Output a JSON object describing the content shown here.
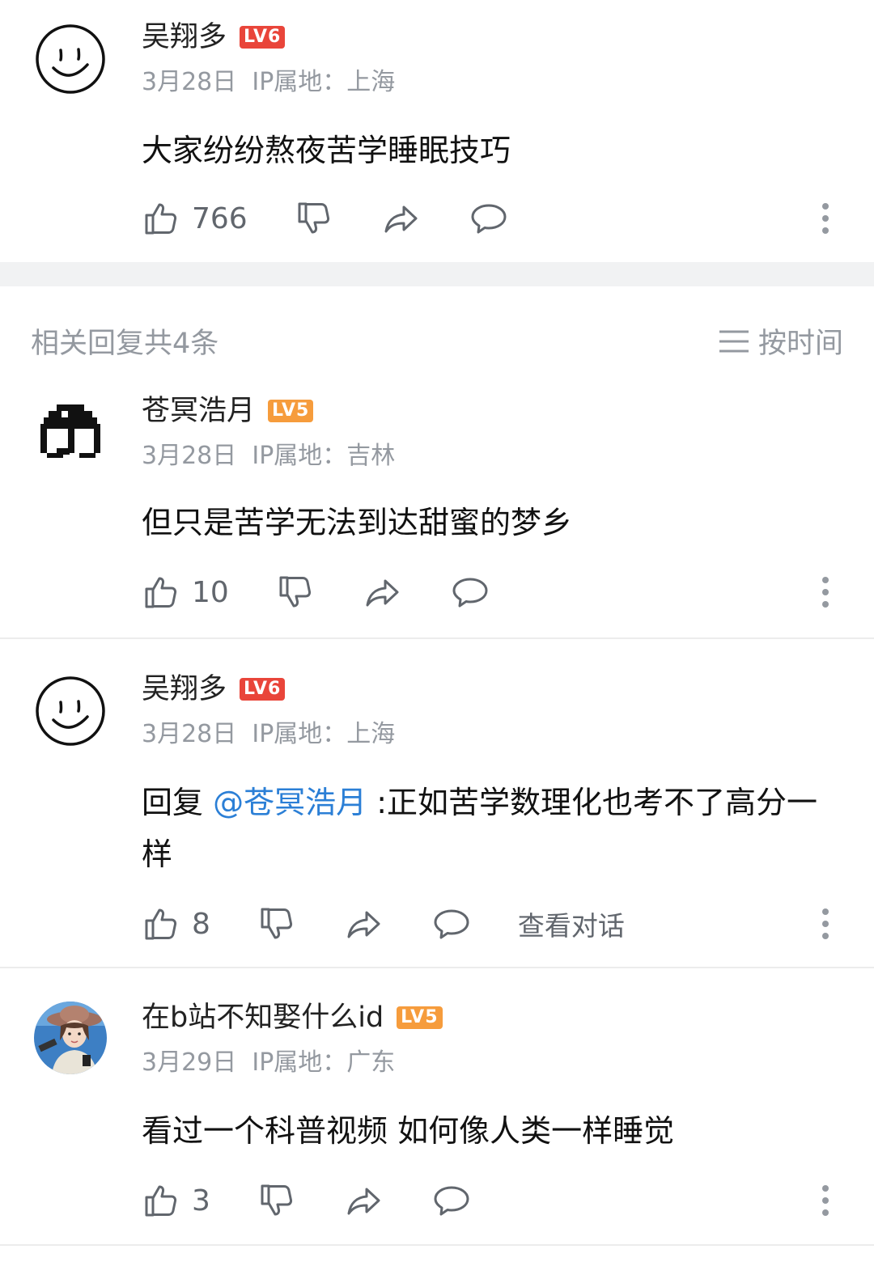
{
  "colors": {
    "accent_link": "#2b7fd6",
    "lv6": "#e9453a",
    "lv5": "#f69c3c",
    "meta_gray": "#9499a0"
  },
  "main_comment": {
    "user": "吴翔多",
    "level": "LV6",
    "date": "3月28日",
    "ip": "IP属地：上海",
    "text": "大家纷纷熬夜苦学睡眠技巧",
    "likes": "766",
    "avatar_icon": "smiley-face-avatar"
  },
  "replies_header": {
    "title": "相关回复共4条",
    "sort_label": "按时间",
    "sort_icon": "sort-lines-icon"
  },
  "replies": [
    {
      "user": "苍冥浩月",
      "level": "LV5",
      "date": "3月28日",
      "ip": "IP属地：吉林",
      "text": "但只是苦学无法到达甜蜜的梦乡",
      "likes": "10",
      "avatar_icon": "pixel-umbrella-avatar"
    },
    {
      "user": "吴翔多",
      "level": "LV6",
      "date": "3月28日",
      "ip": "IP属地：上海",
      "reply_prefix": "回复 ",
      "mention": "@苍冥浩月",
      "text": " :正如苦学数理化也考不了高分一样",
      "likes": "8",
      "view_conversation": "查看对话",
      "avatar_icon": "smiley-face-avatar"
    },
    {
      "user": "在b站不知娶什么id",
      "level": "LV5",
      "date": "3月29日",
      "ip": "IP属地：广东",
      "text": "看过一个科普视频 如何像人类一样睡觉",
      "likes": "3",
      "avatar_icon": "girl-cowboy-hat-avatar"
    }
  ]
}
